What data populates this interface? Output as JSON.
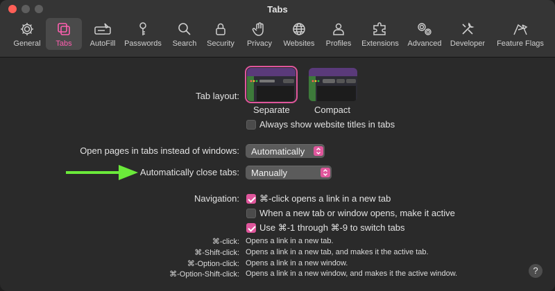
{
  "window": {
    "title": "Tabs"
  },
  "toolbar": {
    "items": [
      {
        "label": "General",
        "icon": "gear-icon"
      },
      {
        "label": "Tabs",
        "icon": "tabs-icon"
      },
      {
        "label": "AutoFill",
        "icon": "autofill-icon"
      },
      {
        "label": "Passwords",
        "icon": "key-icon"
      },
      {
        "label": "Search",
        "icon": "search-icon"
      },
      {
        "label": "Security",
        "icon": "lock-icon"
      },
      {
        "label": "Privacy",
        "icon": "hand-icon"
      },
      {
        "label": "Websites",
        "icon": "globe-icon"
      },
      {
        "label": "Profiles",
        "icon": "person-icon"
      },
      {
        "label": "Extensions",
        "icon": "puzzle-icon"
      },
      {
        "label": "Advanced",
        "icon": "gears-icon"
      },
      {
        "label": "Developer",
        "icon": "tools-icon"
      },
      {
        "label": "Feature Flags",
        "icon": "flags-icon"
      }
    ],
    "selected": "Tabs",
    "accent_color": "#ff5fb0"
  },
  "tab_layout": {
    "label": "Tab layout:",
    "options": [
      "Separate",
      "Compact"
    ],
    "selected": "Separate",
    "always_show_titles": {
      "label": "Always show website titles in tabs",
      "checked": false
    }
  },
  "open_pages": {
    "label": "Open pages in tabs instead of windows:",
    "value": "Automatically"
  },
  "auto_close": {
    "label": "Automatically close tabs:",
    "value": "Manually",
    "arrow_color": "#6bea3a"
  },
  "navigation": {
    "label": "Navigation:",
    "options": [
      {
        "label": "⌘-click opens a link in a new tab",
        "checked": true
      },
      {
        "label": "When a new tab or window opens, make it active",
        "checked": false
      },
      {
        "label": "Use ⌘-1 through ⌘-9 to switch tabs",
        "checked": true
      }
    ]
  },
  "shortcuts": [
    {
      "key": "⌘-click:",
      "desc": "Opens a link in a new tab."
    },
    {
      "key": "⌘-Shift-click:",
      "desc": "Opens a link in a new tab, and makes it the active tab."
    },
    {
      "key": "⌘-Option-click:",
      "desc": "Opens a link in a new window."
    },
    {
      "key": "⌘-Option-Shift-click:",
      "desc": "Opens a link in a new window, and makes it the active window."
    }
  ],
  "help": {
    "label": "?"
  }
}
